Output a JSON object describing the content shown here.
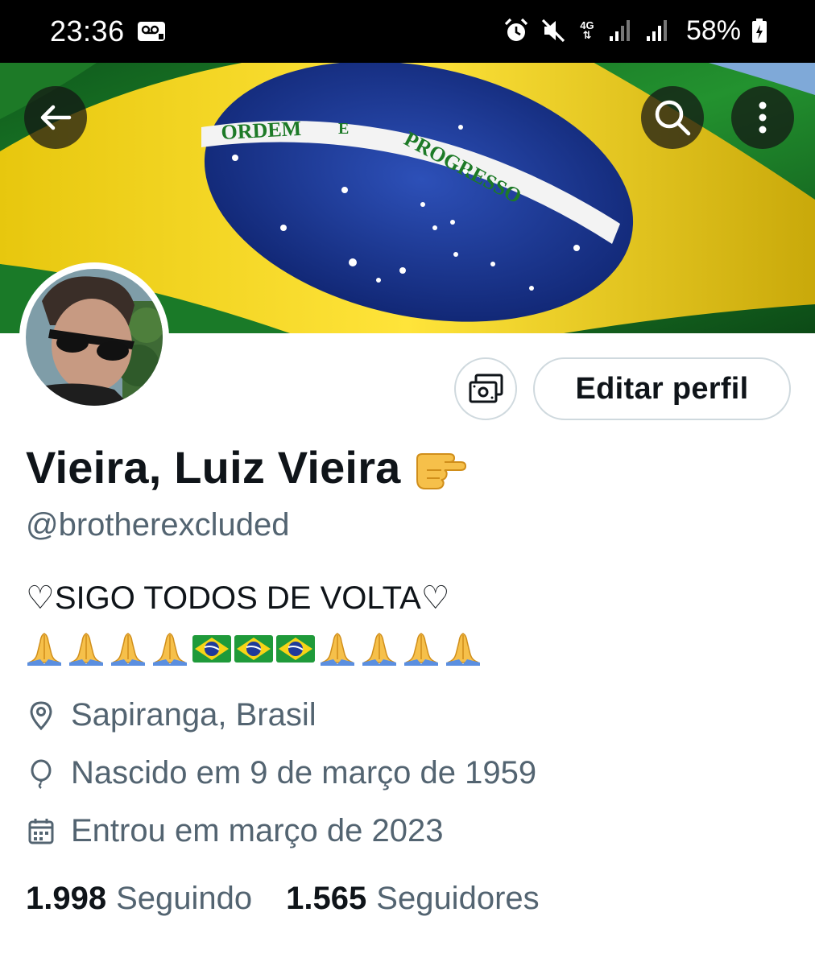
{
  "status_bar": {
    "time": "23:36",
    "battery": "58%",
    "network": "4G",
    "icons": [
      "voicemail-icon",
      "alarm-icon",
      "mute-icon",
      "network-4g-icon",
      "signal-icon",
      "signal-icon",
      "battery-icon"
    ]
  },
  "banner": {
    "motto": "ORDEM E PROGRESSO",
    "colors": {
      "green": "#1f8a2e",
      "yellow": "#f2d21a",
      "blue": "#1f3a9a",
      "white": "#ffffff"
    }
  },
  "header_actions": {
    "back_icon": "arrow-left-icon",
    "search_icon": "search-icon",
    "more_icon": "more-vertical-icon"
  },
  "actions": {
    "monetization_icon": "money-icon",
    "edit_profile_label": "Editar perfil"
  },
  "profile": {
    "name": "Vieira, Luiz Vieira",
    "name_emoji": "pointing-hand-emoji",
    "handle": "@brotherexcluded",
    "bio_line1": "♡SIGO TODOS DE VOLTA♡",
    "bio_emojis": [
      "pray",
      "pray",
      "pray",
      "pray",
      "flag-br",
      "flag-br",
      "flag-br",
      "pray",
      "pray",
      "pray",
      "pray"
    ],
    "location": "Sapiranga, Brasil",
    "born": "Nascido em 9 de março de 1959",
    "joined": "Entrou em março de 2023",
    "following_count": "1.998",
    "following_label": "Seguindo",
    "followers_count": "1.565",
    "followers_label": "Seguidores"
  },
  "theme": {
    "text_primary": "#0f1419",
    "text_secondary": "#536471",
    "border": "#cfd9de"
  }
}
